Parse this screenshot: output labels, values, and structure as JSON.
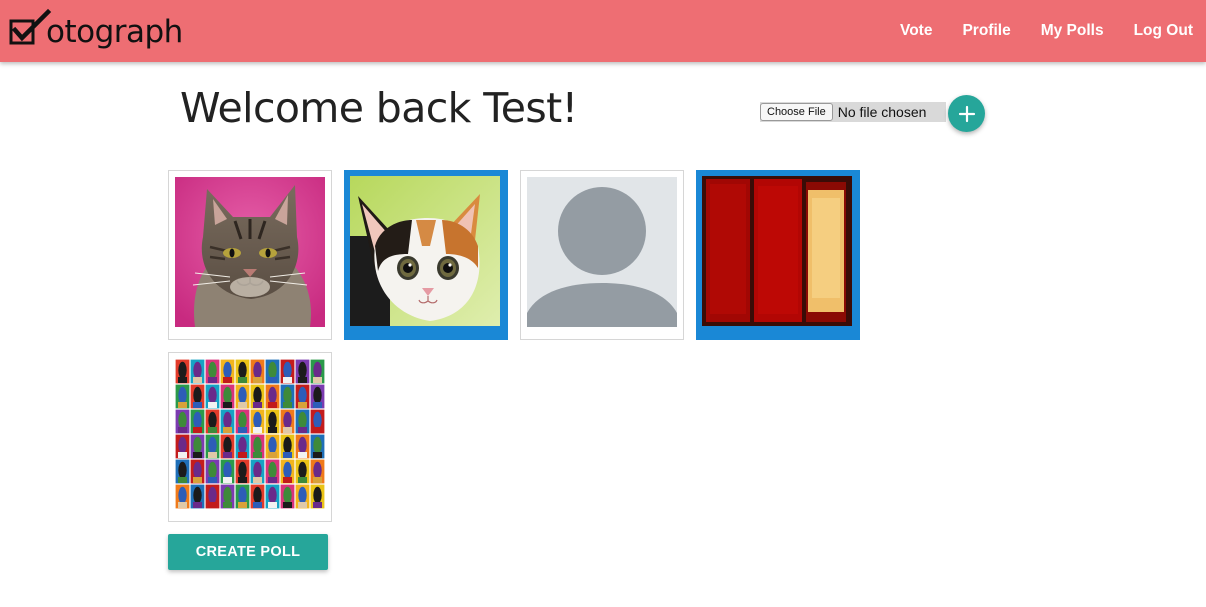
{
  "nav": {
    "brand": "otograph",
    "links": [
      "Vote",
      "Profile",
      "My Polls",
      "Log Out"
    ]
  },
  "main": {
    "title": "Welcome back Test!",
    "upload": {
      "choose_label": "Choose File",
      "status": "No file chosen"
    },
    "images": [
      {
        "subject": "tabby cat on pink background",
        "selected": false
      },
      {
        "subject": "calico kitten",
        "selected": true
      },
      {
        "subject": "default avatar placeholder",
        "selected": false
      },
      {
        "subject": "red and yellow abstract painting",
        "selected": true
      },
      {
        "subject": "grid of superhero portraits",
        "selected": false
      }
    ],
    "create_label": "CREATE POLL"
  },
  "colors": {
    "navbar": "#ee6e73",
    "accent": "#26a69a",
    "selected_border": "#1a88d6"
  }
}
